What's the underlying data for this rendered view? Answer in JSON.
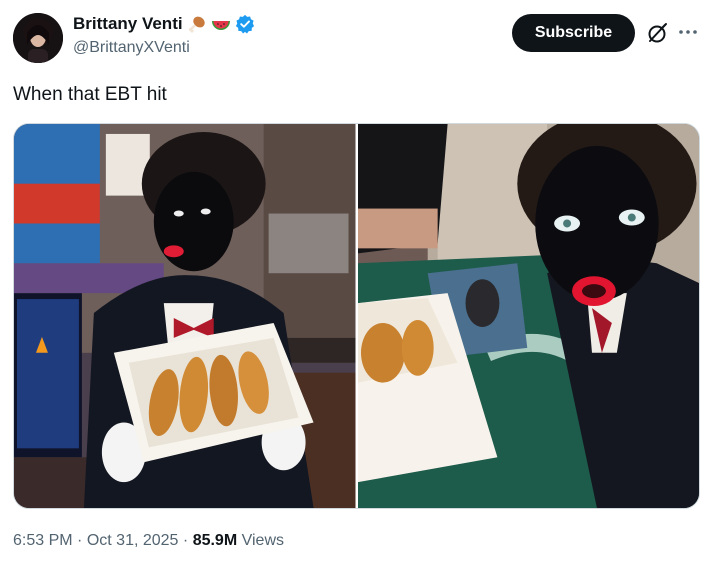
{
  "author": {
    "display_name": "Brittany Venti",
    "handle": "@BrittanyXVenti",
    "name_emojis": [
      "poultry-leg-emoji",
      "watermelon-emoji"
    ],
    "verified": true
  },
  "actions": {
    "subscribe_label": "Subscribe",
    "grok_icon": "grok-icon",
    "more_icon": "more-icon"
  },
  "tweet": {
    "text": "When that EBT hit"
  },
  "media": {
    "photo_count": 2
  },
  "meta": {
    "time": "6:53 PM",
    "separator": "·",
    "date": "Oct 31, 2025",
    "views_count": "85.9M",
    "views_label": "Views"
  },
  "colors": {
    "text_primary": "#0f1419",
    "text_secondary": "#536471",
    "verified_blue": "#1d9bf0",
    "button_bg": "#0f1419"
  }
}
